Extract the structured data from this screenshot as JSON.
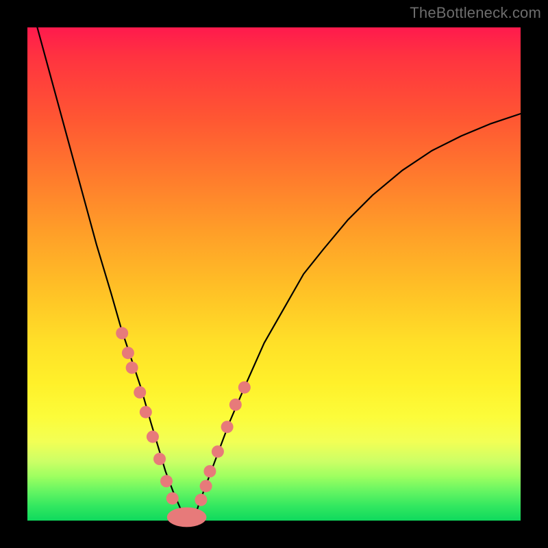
{
  "watermark": "TheBottleneck.com",
  "chart_data": {
    "type": "line",
    "title": "",
    "xlabel": "",
    "ylabel": "",
    "xlim": [
      0,
      100
    ],
    "ylim": [
      0,
      100
    ],
    "grid": false,
    "legend": false,
    "series": [
      {
        "name": "curve",
        "x": [
          2,
          5,
          8,
          11,
          14,
          17,
          19,
          21,
          23,
          25,
          26.5,
          28,
          29.5,
          31,
          32,
          33,
          34,
          35,
          38,
          41,
          44,
          48,
          52,
          56,
          60,
          65,
          70,
          76,
          82,
          88,
          94,
          100
        ],
        "y": [
          100,
          89,
          78,
          67,
          56,
          46,
          39,
          33,
          27,
          20,
          15,
          10,
          6,
          2.5,
          1,
          0.2,
          1,
          4,
          12,
          20,
          27,
          36,
          43,
          50,
          55,
          61,
          66,
          71,
          75,
          78,
          80.5,
          82.5
        ]
      }
    ],
    "markers": {
      "dots": [
        {
          "x": 19.2,
          "y": 38
        },
        {
          "x": 20.4,
          "y": 34
        },
        {
          "x": 21.2,
          "y": 31
        },
        {
          "x": 22.8,
          "y": 26
        },
        {
          "x": 24.0,
          "y": 22
        },
        {
          "x": 25.4,
          "y": 17
        },
        {
          "x": 26.8,
          "y": 12.5
        },
        {
          "x": 37.0,
          "y": 10
        },
        {
          "x": 38.6,
          "y": 14
        },
        {
          "x": 40.5,
          "y": 19
        },
        {
          "x": 42.2,
          "y": 23.5
        },
        {
          "x": 44.0,
          "y": 27
        },
        {
          "x": 36.2,
          "y": 7
        },
        {
          "x": 35.2,
          "y": 4.2
        },
        {
          "x": 28.2,
          "y": 8
        },
        {
          "x": 29.4,
          "y": 4.5
        }
      ],
      "bottom_lozenge": {
        "cx": 32.3,
        "cy": 0.7,
        "rx": 4.0,
        "ry": 2.0
      }
    },
    "colors": {
      "curve": "#000000",
      "marker": "#e77a7a",
      "gradient_top": "#ff1a4d",
      "gradient_bottom": "#0fd95d"
    }
  }
}
